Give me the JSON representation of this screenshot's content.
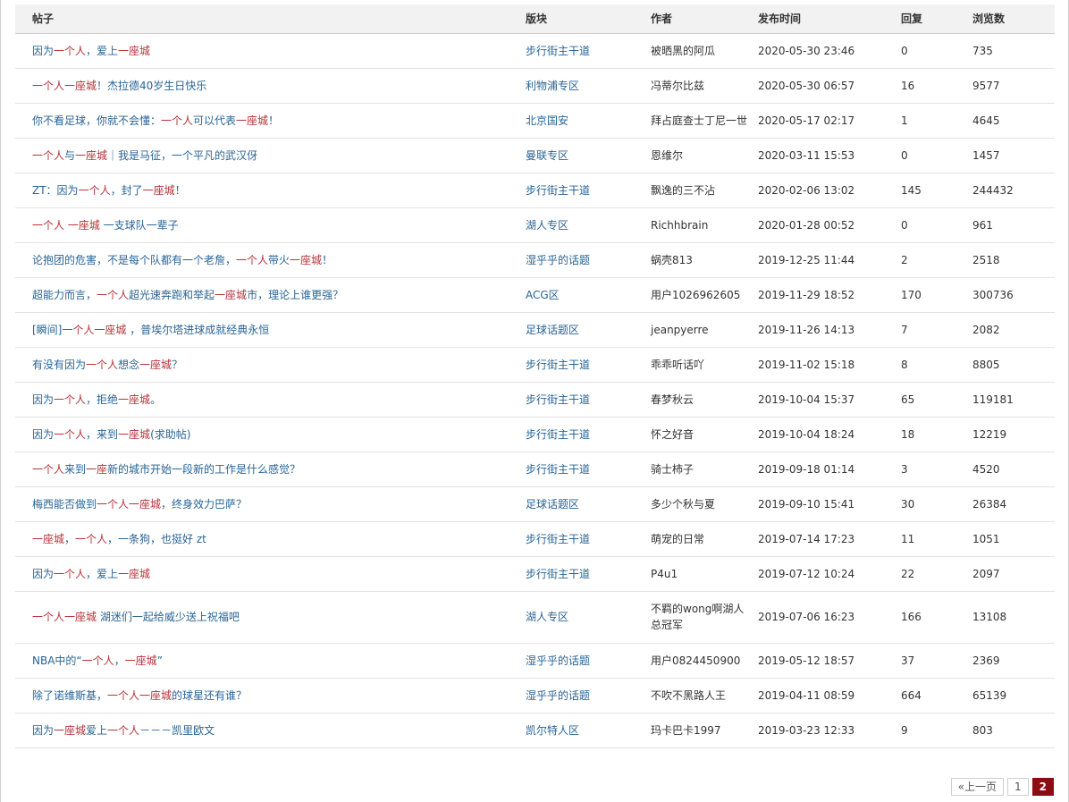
{
  "table": {
    "headers": {
      "title": "帖子",
      "forum": "版块",
      "author": "作者",
      "time": "发布时间",
      "replies": "回复",
      "views": "浏览数"
    },
    "rows": [
      {
        "title_parts": [
          [
            "n",
            "因为"
          ],
          [
            "h",
            "一个人"
          ],
          [
            "n",
            "，爱上"
          ],
          [
            "h",
            "一座城"
          ]
        ],
        "forum": "步行街主干道",
        "author": "被晒黑的阿瓜",
        "time": "2020-05-30 23:46",
        "replies": "0",
        "views": "735"
      },
      {
        "title_parts": [
          [
            "h",
            "一个人一座城"
          ],
          [
            "n",
            "！杰拉德40岁生日快乐"
          ]
        ],
        "forum": "利物浦专区",
        "author": "冯蒂尔比兹",
        "time": "2020-05-30 06:57",
        "replies": "16",
        "views": "9577"
      },
      {
        "title_parts": [
          [
            "n",
            "你不看足球，你就不会懂："
          ],
          [
            "h",
            "一个人"
          ],
          [
            "n",
            "可以代表"
          ],
          [
            "h",
            "一座城"
          ],
          [
            "n",
            "！"
          ]
        ],
        "forum": "北京国安",
        "author": "拜占庭查士丁尼一世",
        "time": "2020-05-17 02:17",
        "replies": "1",
        "views": "4645"
      },
      {
        "title_parts": [
          [
            "h",
            "一个人"
          ],
          [
            "n",
            "与"
          ],
          [
            "h",
            "一座城"
          ],
          [
            "n",
            "｜我是马征，一个平凡的武汉伢"
          ]
        ],
        "forum": "曼联专区",
        "author": "恩维尔",
        "time": "2020-03-11 15:53",
        "replies": "0",
        "views": "1457"
      },
      {
        "title_parts": [
          [
            "n",
            "ZT：因为"
          ],
          [
            "h",
            "一个人"
          ],
          [
            "n",
            "，封了"
          ],
          [
            "h",
            "一座城"
          ],
          [
            "n",
            "！"
          ]
        ],
        "forum": "步行街主干道",
        "author": "飘逸的三不沾",
        "time": "2020-02-06 13:02",
        "replies": "145",
        "views": "244432"
      },
      {
        "title_parts": [
          [
            "h",
            "一个人 一座城"
          ],
          [
            "n",
            " 一支球队一辈子"
          ]
        ],
        "forum": "湖人专区",
        "author": "Richhbrain",
        "time": "2020-01-28 00:52",
        "replies": "0",
        "views": "961"
      },
      {
        "title_parts": [
          [
            "n",
            "论抱团的危害，不是每个队都有一个老詹，"
          ],
          [
            "h",
            "一个人"
          ],
          [
            "n",
            "带火"
          ],
          [
            "h",
            "一座城"
          ],
          [
            "n",
            "！"
          ]
        ],
        "forum": "湿乎乎的话题",
        "author": "蜗壳813",
        "time": "2019-12-25 11:44",
        "replies": "2",
        "views": "2518"
      },
      {
        "title_parts": [
          [
            "n",
            "超能力而言，"
          ],
          [
            "h",
            "一个人"
          ],
          [
            "n",
            "超光速奔跑和举起"
          ],
          [
            "h",
            "一座城"
          ],
          [
            "n",
            "市，理论上谁更强？"
          ]
        ],
        "forum": "ACG区",
        "author": "用户1026962605",
        "time": "2019-11-29 18:52",
        "replies": "170",
        "views": "300736"
      },
      {
        "title_parts": [
          [
            "n",
            "[瞬间]"
          ],
          [
            "h",
            "一个人一座城"
          ],
          [
            "n",
            " ，普埃尔塔进球成就经典永恒"
          ]
        ],
        "forum": "足球话题区",
        "author": "jeanpyerre",
        "time": "2019-11-26 14:13",
        "replies": "7",
        "views": "2082"
      },
      {
        "title_parts": [
          [
            "n",
            "有没有因为"
          ],
          [
            "h",
            "一个人"
          ],
          [
            "n",
            "想念"
          ],
          [
            "h",
            "一座城"
          ],
          [
            "n",
            "？"
          ]
        ],
        "forum": "步行街主干道",
        "author": "乖乖听话吖",
        "time": "2019-11-02 15:18",
        "replies": "8",
        "views": "8805"
      },
      {
        "title_parts": [
          [
            "n",
            "因为"
          ],
          [
            "h",
            "一个人"
          ],
          [
            "n",
            "，拒绝"
          ],
          [
            "h",
            "一座城"
          ],
          [
            "n",
            "。"
          ]
        ],
        "forum": "步行街主干道",
        "author": "春梦秋云",
        "time": "2019-10-04 15:37",
        "replies": "65",
        "views": "119181"
      },
      {
        "title_parts": [
          [
            "n",
            "因为"
          ],
          [
            "h",
            "一个人"
          ],
          [
            "n",
            "，来到"
          ],
          [
            "h",
            "一座城"
          ],
          [
            "n",
            "(求助帖)"
          ]
        ],
        "forum": "步行街主干道",
        "author": "怀之好音",
        "time": "2019-10-04 18:24",
        "replies": "18",
        "views": "12219"
      },
      {
        "title_parts": [
          [
            "h",
            "一个人"
          ],
          [
            "n",
            "来到"
          ],
          [
            "h",
            "一座"
          ],
          [
            "n",
            "新的城市开始一段新的工作是什么感觉？"
          ]
        ],
        "forum": "步行街主干道",
        "author": "骑士柿子",
        "time": "2019-09-18 01:14",
        "replies": "3",
        "views": "4520"
      },
      {
        "title_parts": [
          [
            "n",
            "梅西能否做到"
          ],
          [
            "h",
            "一个人一座城"
          ],
          [
            "n",
            "，终身效力巴萨？"
          ]
        ],
        "forum": "足球话题区",
        "author": "多少个秋与夏",
        "time": "2019-09-10 15:41",
        "replies": "30",
        "views": "26384"
      },
      {
        "title_parts": [
          [
            "h",
            "一座城"
          ],
          [
            "n",
            "，"
          ],
          [
            "h",
            "一个人"
          ],
          [
            "n",
            "，一条狗，也挺好 zt"
          ]
        ],
        "forum": "步行街主干道",
        "author": "萌宠的日常",
        "time": "2019-07-14 17:23",
        "replies": "11",
        "views": "1051"
      },
      {
        "title_parts": [
          [
            "n",
            "因为"
          ],
          [
            "h",
            "一个人"
          ],
          [
            "n",
            "，爱上"
          ],
          [
            "h",
            "一座城"
          ]
        ],
        "forum": "步行街主干道",
        "author": "P4u1",
        "time": "2019-07-12 10:24",
        "replies": "22",
        "views": "2097"
      },
      {
        "title_parts": [
          [
            "h",
            "一个人一座城"
          ],
          [
            "n",
            " 湖迷们一起给威少送上祝福吧"
          ]
        ],
        "forum": "湖人专区",
        "author": "不羁的wong啊湖人总冠军",
        "time": "2019-07-06 16:23",
        "replies": "166",
        "views": "13108",
        "tall": true
      },
      {
        "title_parts": [
          [
            "n",
            "NBA中的“"
          ],
          [
            "h",
            "一个人"
          ],
          [
            "n",
            "，"
          ],
          [
            "h",
            "一座城"
          ],
          [
            "n",
            "”"
          ]
        ],
        "forum": "湿乎乎的话题",
        "author": "用户0824450900",
        "time": "2019-05-12 18:57",
        "replies": "37",
        "views": "2369"
      },
      {
        "title_parts": [
          [
            "n",
            "除了诺维斯基，"
          ],
          [
            "h",
            "一个人一座城"
          ],
          [
            "n",
            "的球星还有谁？"
          ]
        ],
        "forum": "湿乎乎的话题",
        "author": "不吹不黑路人王",
        "time": "2019-04-11 08:59",
        "replies": "664",
        "views": "65139"
      },
      {
        "title_parts": [
          [
            "n",
            "因为"
          ],
          [
            "h",
            "一座城"
          ],
          [
            "n",
            "爱上"
          ],
          [
            "h",
            "一个人"
          ],
          [
            "n",
            "－－－凯里欧文"
          ]
        ],
        "forum": "凯尔特人区",
        "author": "玛卡巴卡1997",
        "time": "2019-03-23 12:33",
        "replies": "9",
        "views": "803"
      }
    ]
  },
  "pagination": {
    "prev_label": "«上一页",
    "pages": [
      "1",
      "2"
    ],
    "current": "2"
  },
  "colors": {
    "link": "#2a6496",
    "highlight": "#b5333a",
    "active_page": "#8b0c12"
  }
}
